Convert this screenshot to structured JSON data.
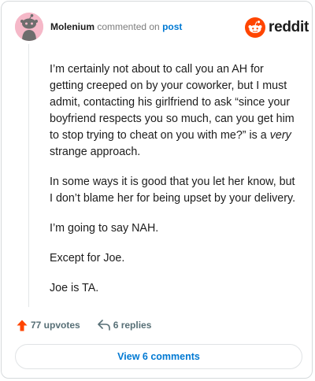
{
  "comment": {
    "author": "Molenium",
    "action_text": "commented on",
    "post_link_text": "post",
    "paragraphs": [
      {
        "before": "I’m certainly not about to call you an AH for getting creeped on by your coworker, but I must admit, contacting his girlfriend to ask “since your boyfriend respects you so much, can you get him to stop trying to cheat on you with me?” is a ",
        "emphasis": "very",
        "after": " strange approach."
      },
      {
        "text": "In some ways it is good that you let her know, but I don’t blame her for being upset by your delivery."
      },
      {
        "text": "I’m going to say NAH."
      },
      {
        "text": "Except for Joe."
      },
      {
        "text": "Joe is TA."
      }
    ]
  },
  "brand": {
    "name": "reddit",
    "icon": "reddit-logo-icon",
    "accent": "#ff4500"
  },
  "footer": {
    "upvotes_label": "77 upvotes",
    "replies_label": "6 replies",
    "upvote_icon": "upvote-arrow-icon",
    "reply_icon": "reply-arrow-icon"
  },
  "view_comments_label": "View 6 comments",
  "colors": {
    "link": "#0079d3",
    "avatar_bg": "#f5b8c8"
  }
}
